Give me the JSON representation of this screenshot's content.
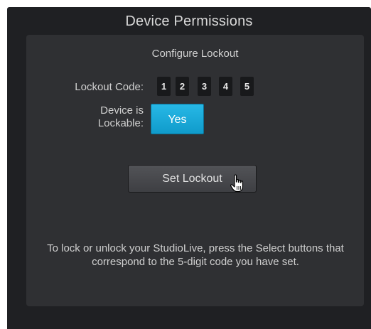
{
  "window": {
    "title": "Device Permissions"
  },
  "panel": {
    "subtitle": "Configure Lockout",
    "lockout_code_label": "Lockout Code:",
    "lockout_code_digits": [
      "1",
      "2",
      "3",
      "4",
      "5"
    ],
    "lockable_label_line1": "Device is",
    "lockable_label_line2": "Lockable:",
    "lockable_button": "Yes",
    "set_lockout_button": "Set Lockout",
    "instructions": "To lock or unlock your StudioLive, press the Select buttons that correspond to the 5-digit code you have set."
  },
  "colors": {
    "window_bg": "#1f2023",
    "panel_bg": "#2f3033",
    "accent": "#1aaede",
    "text": "#d0d0d0"
  },
  "icons": {
    "cursor": "hand-pointer-icon"
  }
}
